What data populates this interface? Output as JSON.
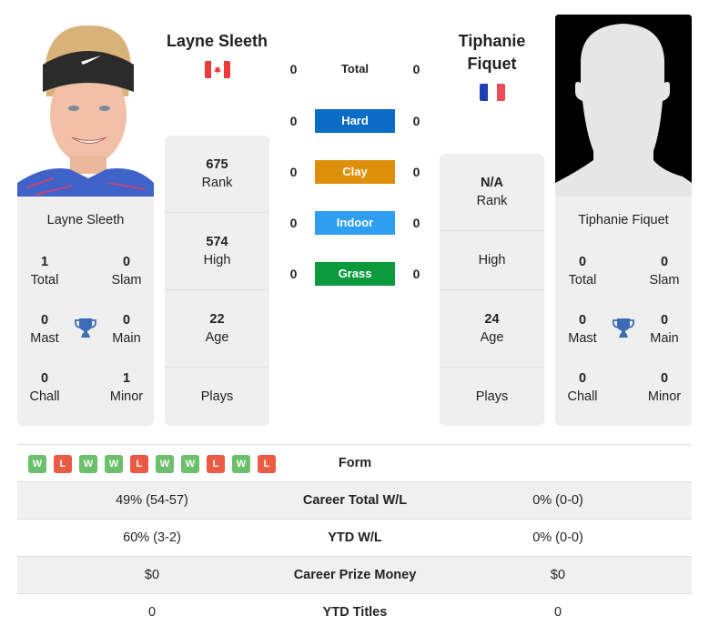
{
  "player1": {
    "name": "Layne Sleeth",
    "country": "Canada",
    "flag_icon": "canada-flag",
    "rank": "675",
    "rank_label": "Rank",
    "high": "574",
    "high_label": "High",
    "age": "22",
    "age_label": "Age",
    "plays": "",
    "plays_label": "Plays",
    "titles": {
      "total": "1",
      "total_label": "Total",
      "slam": "0",
      "slam_label": "Slam",
      "mast": "0",
      "mast_label": "Mast",
      "main": "0",
      "main_label": "Main",
      "chall": "0",
      "chall_label": "Chall",
      "minor": "1",
      "minor_label": "Minor"
    }
  },
  "player2": {
    "name": "Tiphanie Fiquet",
    "name_line1": "Tiphanie",
    "name_line2": "Fiquet",
    "country": "France",
    "flag_icon": "france-flag",
    "rank": "N/A",
    "rank_label": "Rank",
    "high": "",
    "high_label": "High",
    "age": "24",
    "age_label": "Age",
    "plays": "",
    "plays_label": "Plays",
    "titles": {
      "total": "0",
      "total_label": "Total",
      "slam": "0",
      "slam_label": "Slam",
      "mast": "0",
      "mast_label": "Mast",
      "main": "0",
      "main_label": "Main",
      "chall": "0",
      "chall_label": "Chall",
      "minor": "0",
      "minor_label": "Minor"
    }
  },
  "h2h": [
    {
      "label": "Total",
      "p1": "0",
      "p2": "0",
      "color": ""
    },
    {
      "label": "Hard",
      "p1": "0",
      "p2": "0",
      "color": "#0a6cc4"
    },
    {
      "label": "Clay",
      "p1": "0",
      "p2": "0",
      "color": "#de8f0b"
    },
    {
      "label": "Indoor",
      "p1": "0",
      "p2": "0",
      "color": "#2d9ef0"
    },
    {
      "label": "Grass",
      "p1": "0",
      "p2": "0",
      "color": "#0d9a3c"
    }
  ],
  "comparison": {
    "form_label": "Form",
    "form": [
      "W",
      "L",
      "W",
      "W",
      "L",
      "W",
      "W",
      "L",
      "W",
      "L"
    ],
    "rows": [
      {
        "label": "Career Total W/L",
        "p1": "49% (54-57)",
        "p2": "0% (0-0)"
      },
      {
        "label": "YTD W/L",
        "p1": "60% (3-2)",
        "p2": "0% (0-0)"
      },
      {
        "label": "Career Prize Money",
        "p1": "$0",
        "p2": "$0"
      },
      {
        "label": "YTD Titles",
        "p1": "0",
        "p2": "0"
      }
    ]
  },
  "colors": {
    "win": "#6cbf6c",
    "loss": "#eb5a44",
    "trophy": "#3a6db5",
    "card_bg": "#efefef"
  }
}
